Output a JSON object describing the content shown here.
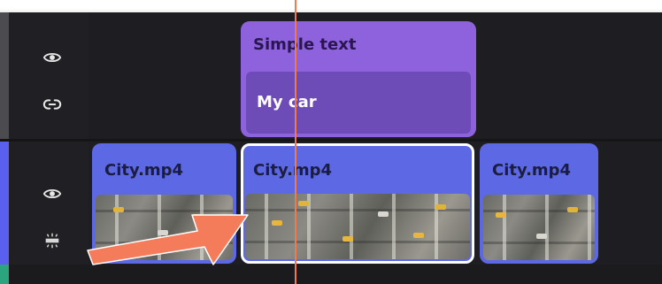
{
  "colors": {
    "background": "#1e1e22",
    "text_clip": "#8e62dc",
    "text_sub": "#6e4cb8",
    "video_clip": "#5d68e4",
    "playhead": "#f07a4f",
    "arrow": "#f47c5a",
    "selected_border": "#ffffff"
  },
  "tracks": {
    "text_track": {
      "controls": [
        {
          "icon": "eye-icon"
        },
        {
          "icon": "link-icon"
        }
      ],
      "clip": {
        "title": "Simple text",
        "content": "My car"
      }
    },
    "video_track": {
      "controls": [
        {
          "icon": "eye-icon"
        },
        {
          "icon": "audio-detach-icon"
        }
      ],
      "clips": [
        {
          "label": "City.mp4",
          "selected": false
        },
        {
          "label": "City.mp4",
          "selected": true
        },
        {
          "label": "City.mp4",
          "selected": false
        }
      ]
    }
  },
  "annotation": {
    "icon": "arrow-icon"
  }
}
